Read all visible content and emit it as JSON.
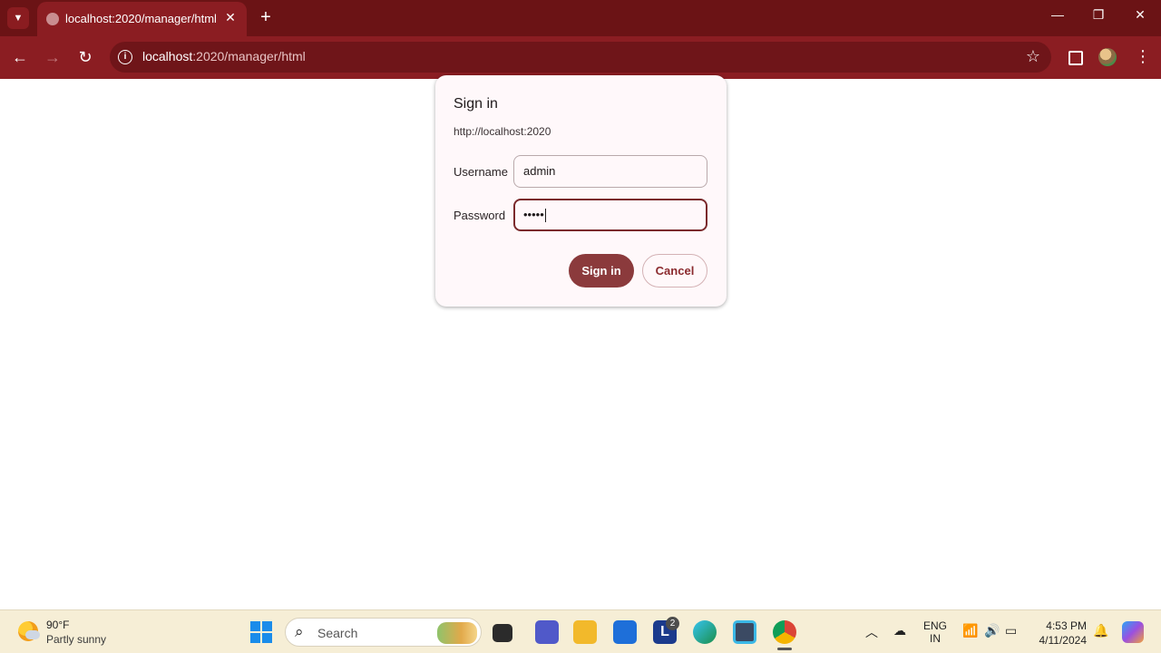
{
  "browser": {
    "tab": {
      "title": "localhost:2020/manager/html"
    },
    "address": {
      "host": "localhost",
      "path": ":2020/manager/html"
    }
  },
  "dialog": {
    "title": "Sign in",
    "origin": "http://localhost:2020",
    "username_label": "Username",
    "username_value": "admin",
    "password_label": "Password",
    "password_mask": "•••••",
    "sign_in_label": "Sign in",
    "cancel_label": "Cancel"
  },
  "taskbar": {
    "weather": {
      "temp": "90°F",
      "desc": "Partly sunny"
    },
    "search_placeholder": "Search",
    "lens_badge": "2",
    "lang": {
      "line1": "ENG",
      "line2": "IN"
    },
    "clock": {
      "time": "4:53 PM",
      "date": "4/11/2024"
    }
  },
  "colors": {
    "accent": "#8b1d22",
    "tabstrip": "#6b1315",
    "primary_button": "#8b3a3c",
    "taskbar": "#f6eed6"
  }
}
